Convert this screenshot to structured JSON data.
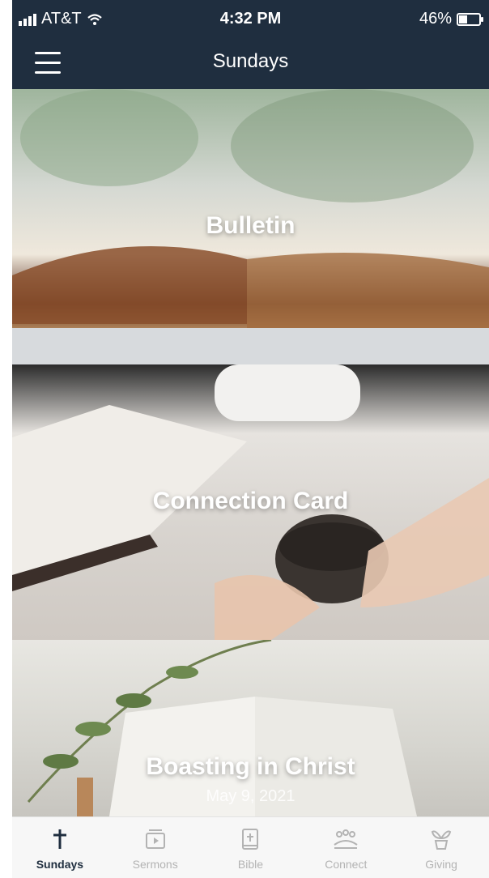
{
  "status_bar": {
    "carrier": "AT&T",
    "time": "4:32 PM",
    "battery": "46%",
    "battery_level": 0.46
  },
  "header": {
    "title": "Sundays",
    "menu_icon": "hamburger-menu-icon"
  },
  "cards": [
    {
      "label": "Bulletin"
    },
    {
      "label": "Connection Card"
    },
    {
      "label": "Boasting in Christ",
      "subtitle": "May 9, 2021"
    }
  ],
  "tabs": [
    {
      "label": "Sundays",
      "icon": "cross-icon",
      "active": true
    },
    {
      "label": "Sermons",
      "icon": "video-play-icon",
      "active": false
    },
    {
      "label": "Bible",
      "icon": "bible-icon",
      "active": false
    },
    {
      "label": "Connect",
      "icon": "people-group-icon",
      "active": false
    },
    {
      "label": "Giving",
      "icon": "plant-pot-icon",
      "active": false
    }
  ],
  "colors": {
    "header_bg": "#1f2e3f",
    "tab_active": "#1f2e3f",
    "tab_inactive": "#b3b3b3"
  }
}
